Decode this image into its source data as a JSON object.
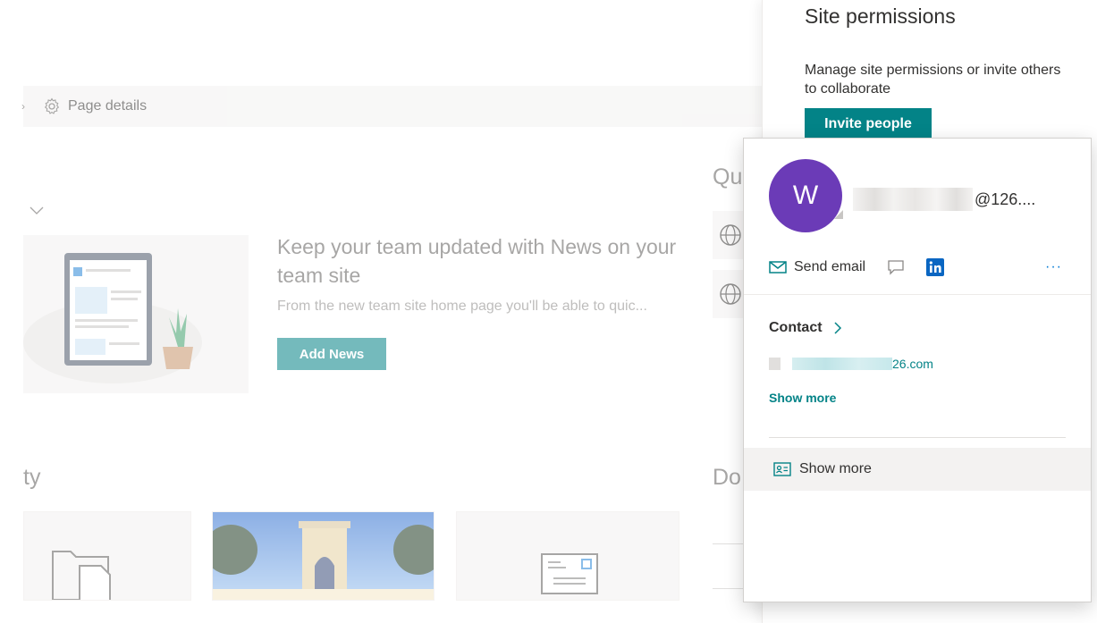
{
  "background": {
    "command_bar": {
      "page_details_label": "Page details"
    },
    "news": {
      "title": "Keep your team updated with News on your team site",
      "description": "From the new team site home page you'll be able to quic...",
      "add_button": "Add News"
    },
    "quick_links_heading": "Qu",
    "activity_heading": "ty",
    "documents_heading": "Do"
  },
  "site_permissions": {
    "title": "Site permissions",
    "description": "Manage site permissions or invite others to collaborate",
    "invite_button": "Invite people"
  },
  "contact_card": {
    "avatar_initial": "W",
    "avatar_color": "#6b3bb7",
    "email_display_suffix": "@126....",
    "actions": {
      "send_email": "Send email",
      "chat_icon": "chat-icon",
      "linkedin_icon": "linkedin-icon",
      "more": "···"
    },
    "contact_section": {
      "heading": "Contact",
      "email_suffix": "26.com",
      "show_more": "Show more"
    },
    "footer_show_more": "Show more"
  },
  "colors": {
    "accent": "#038387",
    "link": "#0078d4",
    "avatar": "#6b3bb7"
  }
}
